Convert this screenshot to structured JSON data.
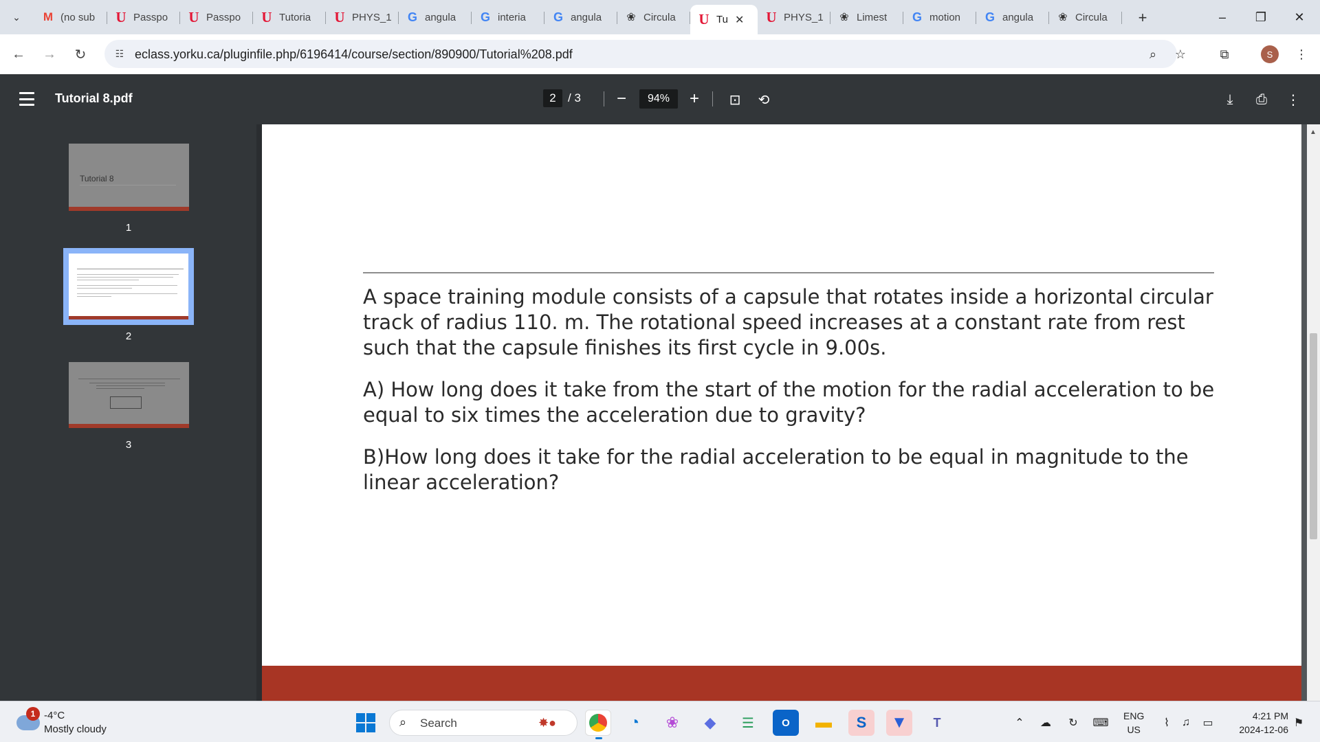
{
  "browser": {
    "tabs": [
      {
        "title": "(no sub",
        "icon": "gmail-icon"
      },
      {
        "title": "Passpo",
        "icon": "york-u-icon"
      },
      {
        "title": "Passpo",
        "icon": "york-u-icon"
      },
      {
        "title": "Tutoria",
        "icon": "york-u-icon"
      },
      {
        "title": "PHYS_1",
        "icon": "york-u-icon"
      },
      {
        "title": "angula",
        "icon": "google-icon"
      },
      {
        "title": "interia",
        "icon": "google-icon"
      },
      {
        "title": "angula",
        "icon": "google-icon"
      },
      {
        "title": "Circula",
        "icon": "chatgpt-icon"
      },
      {
        "title": "Tu",
        "icon": "york-u-icon",
        "active": true
      },
      {
        "title": "PHYS_1",
        "icon": "york-u-icon"
      },
      {
        "title": "Limest",
        "icon": "chatgpt-icon"
      },
      {
        "title": "motion",
        "icon": "google-icon"
      },
      {
        "title": "angula",
        "icon": "google-icon"
      },
      {
        "title": "Circula",
        "icon": "chatgpt-icon"
      }
    ],
    "url": "eclass.yorku.ca/pluginfile.php/6196414/course/section/890900/Tutorial%208.pdf",
    "profile_initial": "S"
  },
  "pdf": {
    "title": "Tutorial 8.pdf",
    "current_page": "2",
    "total_pages": "/ 3",
    "zoom": "94%",
    "thumbnails": [
      {
        "num": "1",
        "caption": "Tutorial 8"
      },
      {
        "num": "2"
      },
      {
        "num": "3"
      }
    ],
    "content": {
      "paragraphs": [
        "A space training module consists of a capsule that rotates inside a horizontal circular track of radius 110. m. The rotational speed increases at a constant rate from rest such that the capsule finishes its first cycle in 9.00s.",
        "A) How long does it take from the start of the motion for the radial acceleration to be equal to six times the acceleration due to gravity?",
        "B)How long does it take for the radial acceleration to be equal in magnitude to the linear acceleration?"
      ]
    }
  },
  "taskbar": {
    "weather_badge": "1",
    "temperature": "-4°C",
    "weather": "Mostly cloudy",
    "search_label": "Search",
    "language": "ENG",
    "region": "US",
    "time": "4:21 PM",
    "date": "2024-12-06"
  },
  "colors": {
    "viewer_bg": "#323639",
    "page_footer": "#a83524",
    "selection": "#8ab4f8"
  }
}
